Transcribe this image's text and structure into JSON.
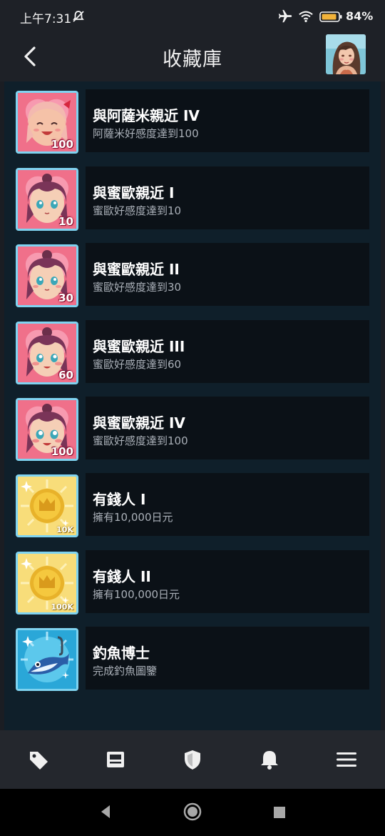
{
  "status": {
    "time": "上午7:31",
    "battery": "84%"
  },
  "header": {
    "title": "收藏庫"
  },
  "achievements": [
    {
      "title": "與阿薩米親近 IV",
      "desc": "阿薩米好感度達到100",
      "badge_label": "100",
      "badge_type": "girl-blonde"
    },
    {
      "title": "與蜜歐親近 I",
      "desc": "蜜歐好感度達到10",
      "badge_label": "10",
      "badge_type": "girl-brunette"
    },
    {
      "title": "與蜜歐親近 II",
      "desc": "蜜歐好感度達到30",
      "badge_label": "30",
      "badge_type": "girl-brunette"
    },
    {
      "title": "與蜜歐親近 III",
      "desc": "蜜歐好感度達到60",
      "badge_label": "60",
      "badge_type": "girl-brunette"
    },
    {
      "title": "與蜜歐親近 IV",
      "desc": "蜜歐好感度達到100",
      "badge_label": "100",
      "badge_type": "girl-brunette"
    },
    {
      "title": "有錢人 I",
      "desc": "擁有10,000日元",
      "badge_label": "10K",
      "badge_type": "gold-coin"
    },
    {
      "title": "有錢人 II",
      "desc": "擁有100,000日元",
      "badge_label": "100K",
      "badge_type": "gold-coin"
    },
    {
      "title": "釣魚博士",
      "desc": "完成釣魚圖鑒",
      "badge_label": "",
      "badge_type": "fish"
    }
  ],
  "bottom_nav": [
    "tag-icon",
    "news-icon",
    "shield-icon",
    "bell-icon",
    "menu-icon"
  ],
  "colors": {
    "accent_border": "#7fd3f0",
    "card_bg": "#0b1117",
    "list_bg": "#0f1f2a"
  }
}
